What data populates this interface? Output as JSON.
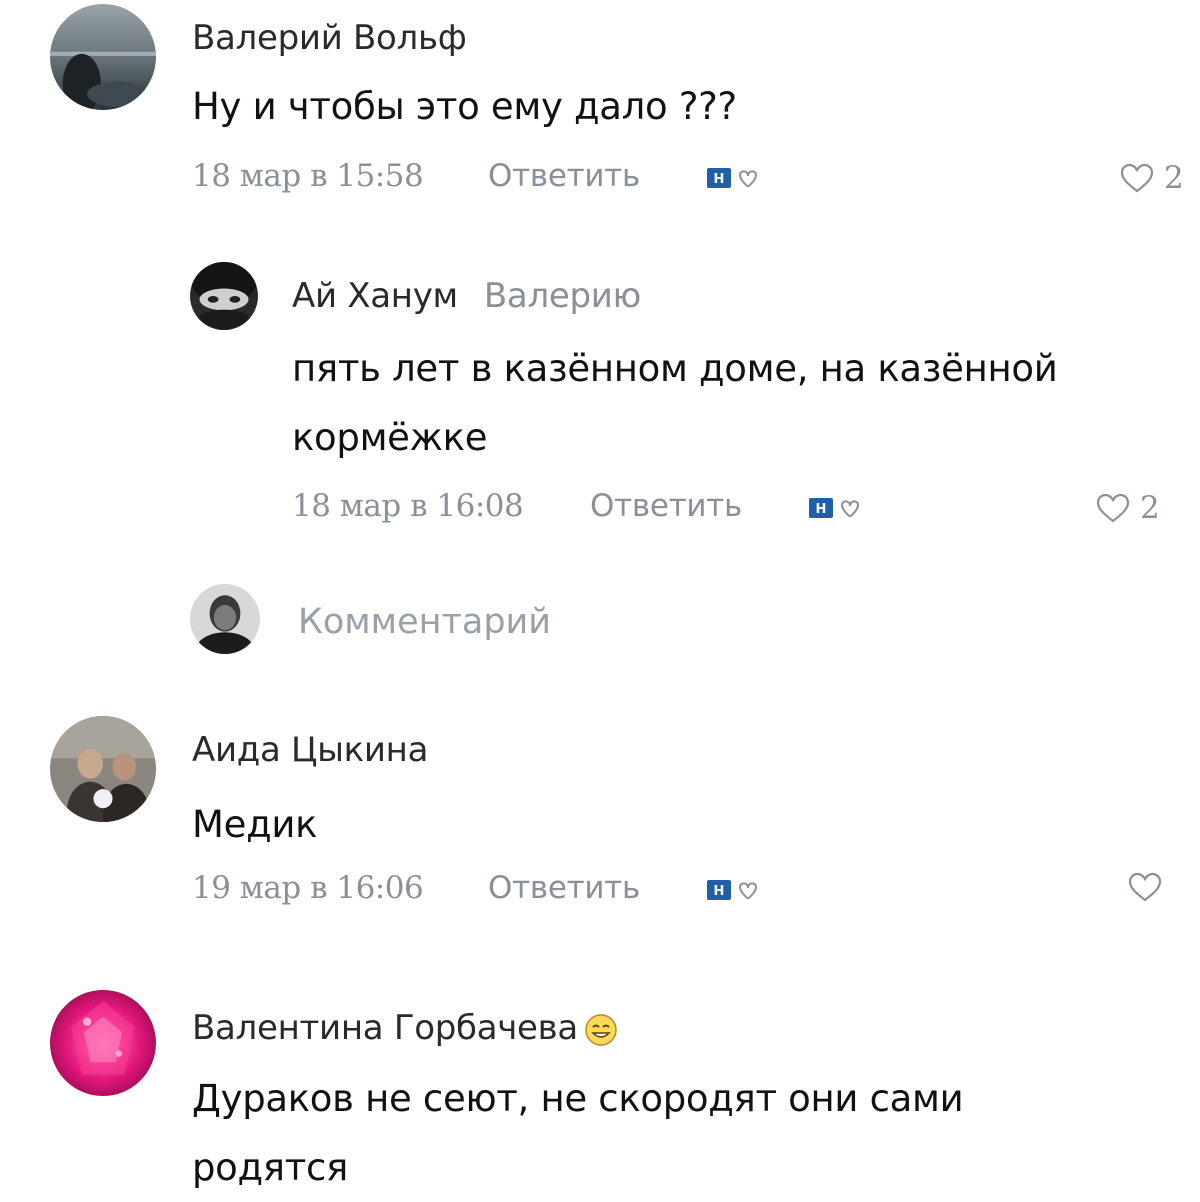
{
  "comments": [
    {
      "author": "Валерий Вольф",
      "text_lines": [
        "Ну и чтобы это ему дало ???"
      ],
      "date": "18 мар в 15:58",
      "reply_label": "Ответить",
      "likes": "2"
    },
    {
      "author": "Ай Ханум",
      "reply_to": "Валерию",
      "text_lines": [
        "пять лет в казённом доме, на казённой",
        "кормёжке"
      ],
      "date": "18 мар в 16:08",
      "reply_label": "Ответить",
      "likes": "2"
    },
    {
      "author": "Аида Цыкина",
      "text_lines": [
        "Медик"
      ],
      "date": "19 мар в 16:06",
      "reply_label": "Ответить",
      "likes": ""
    },
    {
      "author": "Валентина Горбачева",
      "author_emoji": "smiling-face-emoji",
      "text_lines": [
        "Дураков не сеют, не скородят они сами",
        "родятся"
      ]
    }
  ],
  "reply_box": {
    "placeholder": "Комментарий"
  },
  "icons": {
    "badge": "news-badge-icon",
    "like": "heart-outline-icon"
  },
  "colors": {
    "meta_text": "#8a8f99",
    "main_text": "#111111",
    "badge_blue": "#1f5fa8"
  }
}
